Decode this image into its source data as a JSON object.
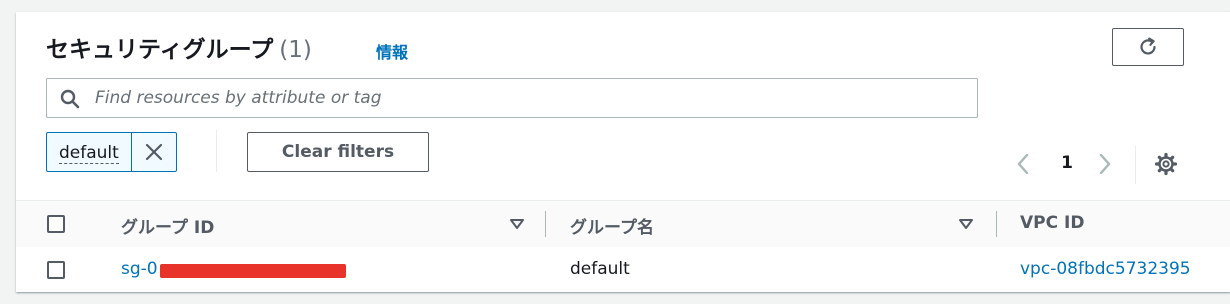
{
  "header": {
    "title": "セキュリティグループ",
    "count": "(1)",
    "info_link": "情報",
    "refresh_icon": "refresh-icon"
  },
  "search": {
    "placeholder": "Find resources by attribute or tag",
    "value": "",
    "icon": "search-icon"
  },
  "filters": {
    "tokens": [
      {
        "label": "default",
        "dismiss_icon": "close-icon"
      }
    ],
    "clear_label": "Clear filters"
  },
  "pagination": {
    "current_page": "1",
    "prev_icon": "chevron-left-icon",
    "next_icon": "chevron-right-icon",
    "settings_icon": "gear-icon"
  },
  "table": {
    "columns": [
      {
        "label": "グループ ID",
        "sortable": true
      },
      {
        "label": "グループ名",
        "sortable": true
      },
      {
        "label": "VPC ID",
        "sortable": false
      }
    ],
    "rows": [
      {
        "group_id_prefix": "sg-0",
        "group_id_redacted": true,
        "group_name": "default",
        "vpc_id": "vpc-08fbdc5732395"
      }
    ]
  },
  "colors": {
    "link": "#0073bb",
    "border_dark": "#545b64",
    "redaction": "#e8332a",
    "background": "#f2f3f3"
  }
}
